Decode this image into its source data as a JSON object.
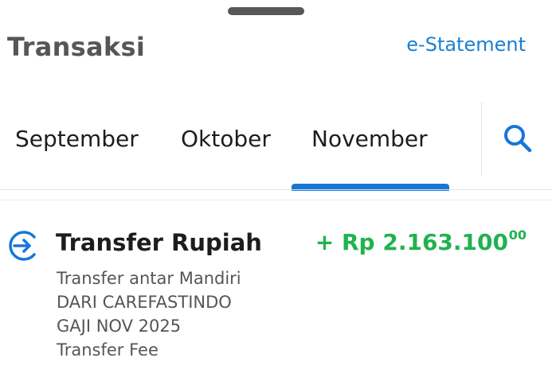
{
  "header": {
    "title": "Transaksi",
    "estatement_label": "e-Statement"
  },
  "tabs": {
    "items": [
      {
        "label": "September"
      },
      {
        "label": "Oktober"
      },
      {
        "label": "November"
      }
    ],
    "selected": "November",
    "search_icon": "search-icon"
  },
  "transaction": {
    "icon": "transfer-arrow-icon",
    "type": "Transfer Rupiah",
    "amount": "+ Rp 2.163.100",
    "amount_decimals": "00",
    "details": [
      "Transfer antar Mandiri",
      "DARI CAREFASTINDO",
      "GAJI NOV 2025",
      "Transfer Fee"
    ]
  },
  "colors": {
    "accent": "#1677d9",
    "link": "#1a7fd4",
    "credit": "#21b24e",
    "title": "#55555a"
  }
}
